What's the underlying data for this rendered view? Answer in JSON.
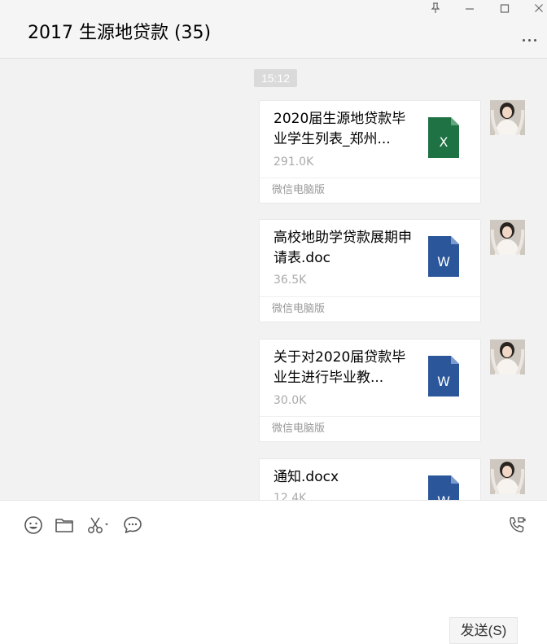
{
  "window": {
    "title": "2017 生源地贷款 (35)",
    "pin_icon": "pin-icon",
    "minimize_icon": "minimize-icon",
    "maximize_icon": "maximize-icon",
    "close_icon": "close-icon",
    "more_icon": "more-dots-icon"
  },
  "chat": {
    "timestamp": "15:12",
    "messages": [
      {
        "filename": "2020届生源地贷款毕业学生列表_郑州...",
        "size": "291.0K",
        "source": "微信电脑版",
        "file_type": "excel",
        "icon_letter": "X",
        "icon_color": "#1f7244"
      },
      {
        "filename": "高校地助学贷款展期申请表.doc",
        "size": "36.5K",
        "source": "微信电脑版",
        "file_type": "word",
        "icon_letter": "W",
        "icon_color": "#2b579a"
      },
      {
        "filename": "关于对2020届贷款毕业生进行毕业教...",
        "size": "30.0K",
        "source": "微信电脑版",
        "file_type": "word",
        "icon_letter": "W",
        "icon_color": "#2b579a"
      },
      {
        "filename": "通知.docx",
        "size": "12.4K",
        "source": "",
        "file_type": "word",
        "icon_letter": "W",
        "icon_color": "#2b579a"
      }
    ]
  },
  "toolbar": {
    "emoji_icon": "emoji-icon",
    "folder_icon": "folder-icon",
    "scissors_icon": "scissors-icon",
    "chat_bubble_icon": "chat-bubble-icon",
    "call_icon": "phone-call-icon"
  },
  "input": {
    "value": "",
    "send_label": "发送(S)"
  },
  "colors": {
    "excel": "#1f7244",
    "word": "#2b579a"
  }
}
